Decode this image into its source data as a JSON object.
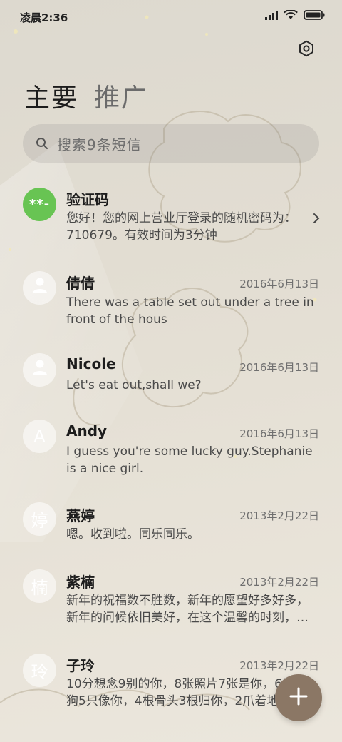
{
  "status_bar": {
    "time": "凌晨2:36",
    "icons": [
      "signal-icon",
      "wifi-icon",
      "battery-icon"
    ]
  },
  "header": {
    "settings_icon": "gear-icon",
    "tabs": [
      {
        "label": "主要",
        "active": true
      },
      {
        "label": "推广",
        "active": false
      }
    ]
  },
  "search": {
    "placeholder": "搜索9条短信"
  },
  "conversations": [
    {
      "name": "验证码",
      "avatar_text": "**-",
      "avatar_color": "#68c453",
      "date": "",
      "preview": "您好！您的网上营业厅登录的随机密码为：710679。有效时间为3分钟",
      "has_chevron": true
    },
    {
      "name": "倩倩",
      "avatar_text": "",
      "date": "2016年6月13日",
      "preview": "There was a table set out under a tree in front of the hous"
    },
    {
      "name": "Nicole",
      "avatar_text": "",
      "date": "2016年6月13日",
      "preview": "Let's eat out,shall we?"
    },
    {
      "name": "Andy",
      "avatar_text": "A",
      "date": "2016年6月13日",
      "preview": "I guess you're some lucky guy.Stephanie is a nice girl."
    },
    {
      "name": "燕婷",
      "avatar_text": "婷",
      "date": "2013年2月22日",
      "preview": "嗯。收到啦。同乐同乐。"
    },
    {
      "name": "紫楠",
      "avatar_text": "楠",
      "date": "2013年2月22日",
      "preview": "新年的祝福数不胜数，新年的愿望好多好多，新年的问候依旧美好，在这个温馨的时刻，…"
    },
    {
      "name": "子玲",
      "avatar_text": "玲",
      "date": "2013年2月22日",
      "preview": "10分想念9别的你，8张照片7张是你，6只小狗5只像你，4根骨头3根归你，2爪着地"
    }
  ],
  "fab": {
    "icon": "plus-icon"
  }
}
